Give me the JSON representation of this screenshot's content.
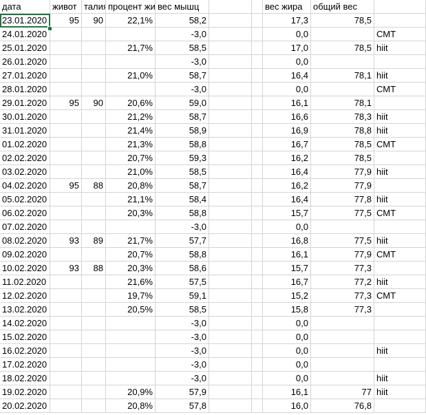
{
  "sheet": {
    "headers": [
      "дата",
      "живот",
      "талия",
      "процент жира",
      "вес мышц",
      "",
      "",
      "вес жира",
      "общий вес",
      ""
    ],
    "rows": [
      [
        "23.01.2020",
        "95",
        "90",
        "22,1%",
        "58,2",
        "",
        "",
        "17,3",
        "78,5",
        ""
      ],
      [
        "24.01.2020",
        "",
        "",
        "",
        "-3,0",
        "",
        "",
        "0,0",
        "",
        "СМТ"
      ],
      [
        "25.01.2020",
        "",
        "",
        "21,7%",
        "58,5",
        "",
        "",
        "17,0",
        "78,5",
        "hiit"
      ],
      [
        "26.01.2020",
        "",
        "",
        "",
        "-3,0",
        "",
        "",
        "0,0",
        "",
        ""
      ],
      [
        "27.01.2020",
        "",
        "",
        "21,0%",
        "58,7",
        "",
        "",
        "16,4",
        "78,1",
        "hiit"
      ],
      [
        "28.01.2020",
        "",
        "",
        "",
        "-3,0",
        "",
        "",
        "0,0",
        "",
        "СМТ"
      ],
      [
        "29.01.2020",
        "95",
        "90",
        "20,6%",
        "59,0",
        "",
        "",
        "16,1",
        "78,1",
        ""
      ],
      [
        "30.01.2020",
        "",
        "",
        "21,2%",
        "58,7",
        "",
        "",
        "16,6",
        "78,3",
        "hiit"
      ],
      [
        "31.01.2020",
        "",
        "",
        "21,4%",
        "58,9",
        "",
        "",
        "16,9",
        "78,8",
        "hiit"
      ],
      [
        "01.02.2020",
        "",
        "",
        "21,3%",
        "58,8",
        "",
        "",
        "16,7",
        "78,5",
        "СМТ"
      ],
      [
        "02.02.2020",
        "",
        "",
        "20,7%",
        "59,3",
        "",
        "",
        "16,2",
        "78,5",
        ""
      ],
      [
        "03.02.2020",
        "",
        "",
        "21,0%",
        "58,5",
        "",
        "",
        "16,4",
        "77,9",
        "hiit"
      ],
      [
        "04.02.2020",
        "95",
        "88",
        "20,8%",
        "58,7",
        "",
        "",
        "16,2",
        "77,9",
        ""
      ],
      [
        "05.02.2020",
        "",
        "",
        "21,1%",
        "58,4",
        "",
        "",
        "16,4",
        "77,8",
        "hiit"
      ],
      [
        "06.02.2020",
        "",
        "",
        "20,3%",
        "58,8",
        "",
        "",
        "15,7",
        "77,5",
        "СМТ"
      ],
      [
        "07.02.2020",
        "",
        "",
        "",
        "-3,0",
        "",
        "",
        "0,0",
        "",
        ""
      ],
      [
        "08.02.2020",
        "93",
        "89",
        "21,7%",
        "57,7",
        "",
        "",
        "16,8",
        "77,5",
        "hiit"
      ],
      [
        "09.02.2020",
        "",
        "",
        "20,7%",
        "58,8",
        "",
        "",
        "16,1",
        "77,9",
        "СМТ"
      ],
      [
        "10.02.2020",
        "93",
        "88",
        "20,3%",
        "58,6",
        "",
        "",
        "15,7",
        "77,3",
        ""
      ],
      [
        "11.02.2020",
        "",
        "",
        "21,6%",
        "57,5",
        "",
        "",
        "16,7",
        "77,2",
        "hiit"
      ],
      [
        "12.02.2020",
        "",
        "",
        "19,7%",
        "59,1",
        "",
        "",
        "15,2",
        "77,3",
        "СМТ"
      ],
      [
        "13.02.2020",
        "",
        "",
        "20,5%",
        "58,5",
        "",
        "",
        "15,8",
        "77,3",
        ""
      ],
      [
        "14.02.2020",
        "",
        "",
        "",
        "-3,0",
        "",
        "",
        "0,0",
        "",
        ""
      ],
      [
        "15.02.2020",
        "",
        "",
        "",
        "-3,0",
        "",
        "",
        "0,0",
        "",
        ""
      ],
      [
        "16.02.2020",
        "",
        "",
        "",
        "-3,0",
        "",
        "",
        "0,0",
        "",
        "hiit"
      ],
      [
        "17.02.2020",
        "",
        "",
        "",
        "-3,0",
        "",
        "",
        "0,0",
        "",
        ""
      ],
      [
        "18.02.2020",
        "",
        "",
        "",
        "-3,0",
        "",
        "",
        "0,0",
        "",
        "hiit"
      ],
      [
        "19.02.2020",
        "",
        "",
        "20,9%",
        "57,9",
        "",
        "",
        "16,1",
        "77",
        "hiit"
      ],
      [
        "20.02.2020",
        "",
        "",
        "20,8%",
        "57,8",
        "",
        "",
        "16,0",
        "76,8",
        ""
      ]
    ]
  }
}
